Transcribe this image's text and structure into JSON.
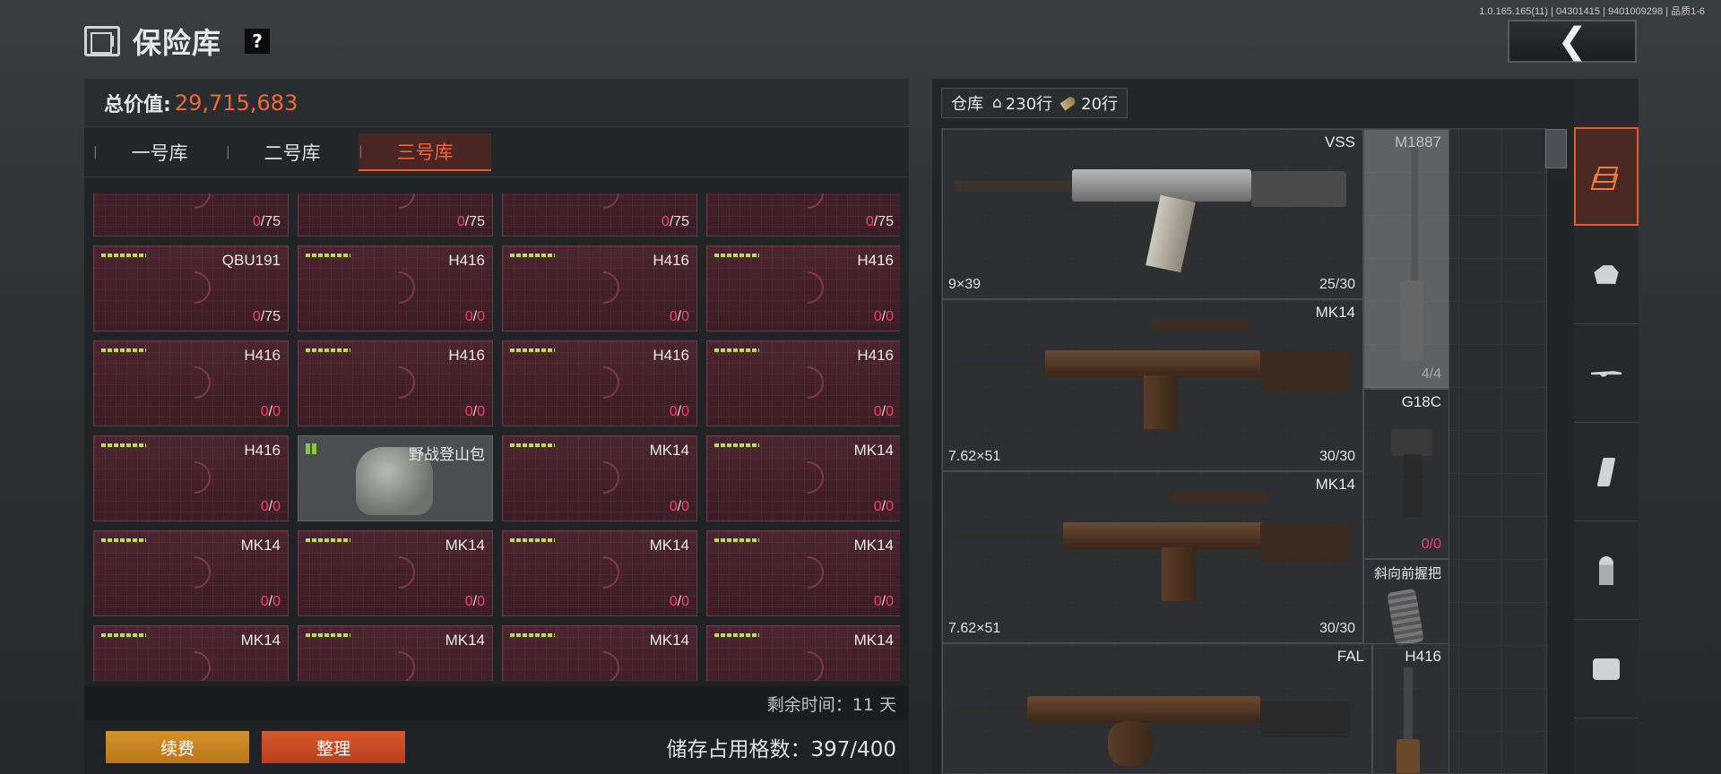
{
  "version": "1.0.165.165(11) | 04301415 | 9401009298 | 品质1-6",
  "header": {
    "title": "保险库",
    "help": "?",
    "back_icon": "chevron-left-icon"
  },
  "left": {
    "total_label": "总价值:",
    "total_value": "29,715,683",
    "tabs": [
      {
        "label": "一号库",
        "active": false
      },
      {
        "label": "二号库",
        "active": false
      },
      {
        "label": "三号库",
        "active": true
      }
    ],
    "grid": [
      {
        "name": "",
        "cur": "0",
        "max": "75",
        "dots": false
      },
      {
        "name": "",
        "cur": "0",
        "max": "75",
        "dots": false
      },
      {
        "name": "",
        "cur": "0",
        "max": "75",
        "dots": false
      },
      {
        "name": "",
        "cur": "0",
        "max": "75",
        "dots": false
      },
      {
        "name": "QBU191",
        "cur": "0",
        "max": "75",
        "dots": true
      },
      {
        "name": "H416",
        "cur": "0",
        "max": "0",
        "dots": true
      },
      {
        "name": "H416",
        "cur": "0",
        "max": "0",
        "dots": true
      },
      {
        "name": "H416",
        "cur": "0",
        "max": "0",
        "dots": true
      },
      {
        "name": "H416",
        "cur": "0",
        "max": "0",
        "dots": true
      },
      {
        "name": "H416",
        "cur": "0",
        "max": "0",
        "dots": true
      },
      {
        "name": "H416",
        "cur": "0",
        "max": "0",
        "dots": true
      },
      {
        "name": "H416",
        "cur": "0",
        "max": "0",
        "dots": true
      },
      {
        "name": "H416",
        "cur": "0",
        "max": "0",
        "dots": true
      },
      {
        "name": "野战登山包",
        "item": true
      },
      {
        "name": "MK14",
        "cur": "0",
        "max": "0",
        "dots": true
      },
      {
        "name": "MK14",
        "cur": "0",
        "max": "0",
        "dots": true
      },
      {
        "name": "MK14",
        "cur": "0",
        "max": "0",
        "dots": true
      },
      {
        "name": "MK14",
        "cur": "0",
        "max": "0",
        "dots": true
      },
      {
        "name": "MK14",
        "cur": "0",
        "max": "0",
        "dots": true
      },
      {
        "name": "MK14",
        "cur": "0",
        "max": "0",
        "dots": true
      },
      {
        "name": "MK14",
        "cur": "",
        "max": "",
        "dots": true
      },
      {
        "name": "MK14",
        "cur": "",
        "max": "",
        "dots": true
      },
      {
        "name": "MK14",
        "cur": "",
        "max": "",
        "dots": true
      },
      {
        "name": "MK14",
        "cur": "",
        "max": "",
        "dots": true
      }
    ],
    "remaining": "剩余时间：11 天",
    "renew_label": "续费",
    "sort_label": "整理",
    "capacity": "储存占用格数：397/400"
  },
  "right": {
    "warehouse_label": "仓库",
    "home_rows": "230行",
    "ammo_rows": "20行",
    "items": [
      {
        "name": "VSS",
        "caliber": "9×39",
        "cur": "25",
        "max": "30"
      },
      {
        "name": "MK14",
        "caliber": "7.62×51",
        "cur": "30",
        "max": "30"
      },
      {
        "name": "MK14",
        "caliber": "7.62×51",
        "cur": "30",
        "max": "30"
      },
      {
        "name": "FAL",
        "caliber": "",
        "cur": "",
        "max": ""
      },
      {
        "name": "M1887",
        "caliber": "",
        "cur": "4",
        "max": "4"
      },
      {
        "name": "G18C",
        "caliber": "",
        "cur": "0",
        "max": "0"
      },
      {
        "name": "斜向前握把",
        "caliber": "",
        "cur": "",
        "max": ""
      },
      {
        "name": "H416",
        "caliber": "",
        "cur": "",
        "max": ""
      }
    ]
  },
  "sidebar": [
    {
      "icon": "layers-icon",
      "active": true
    },
    {
      "icon": "helmet-icon",
      "active": false
    },
    {
      "icon": "rifle-icon",
      "active": false
    },
    {
      "icon": "magazine-icon",
      "active": false
    },
    {
      "icon": "ammo-icon",
      "active": false
    },
    {
      "icon": "sight-icon",
      "active": false
    }
  ],
  "colors": {
    "accent": "#e65a2a",
    "value": "#f0683a",
    "ammo_empty": "#ff3b6a",
    "quality": "#b9e04a"
  }
}
